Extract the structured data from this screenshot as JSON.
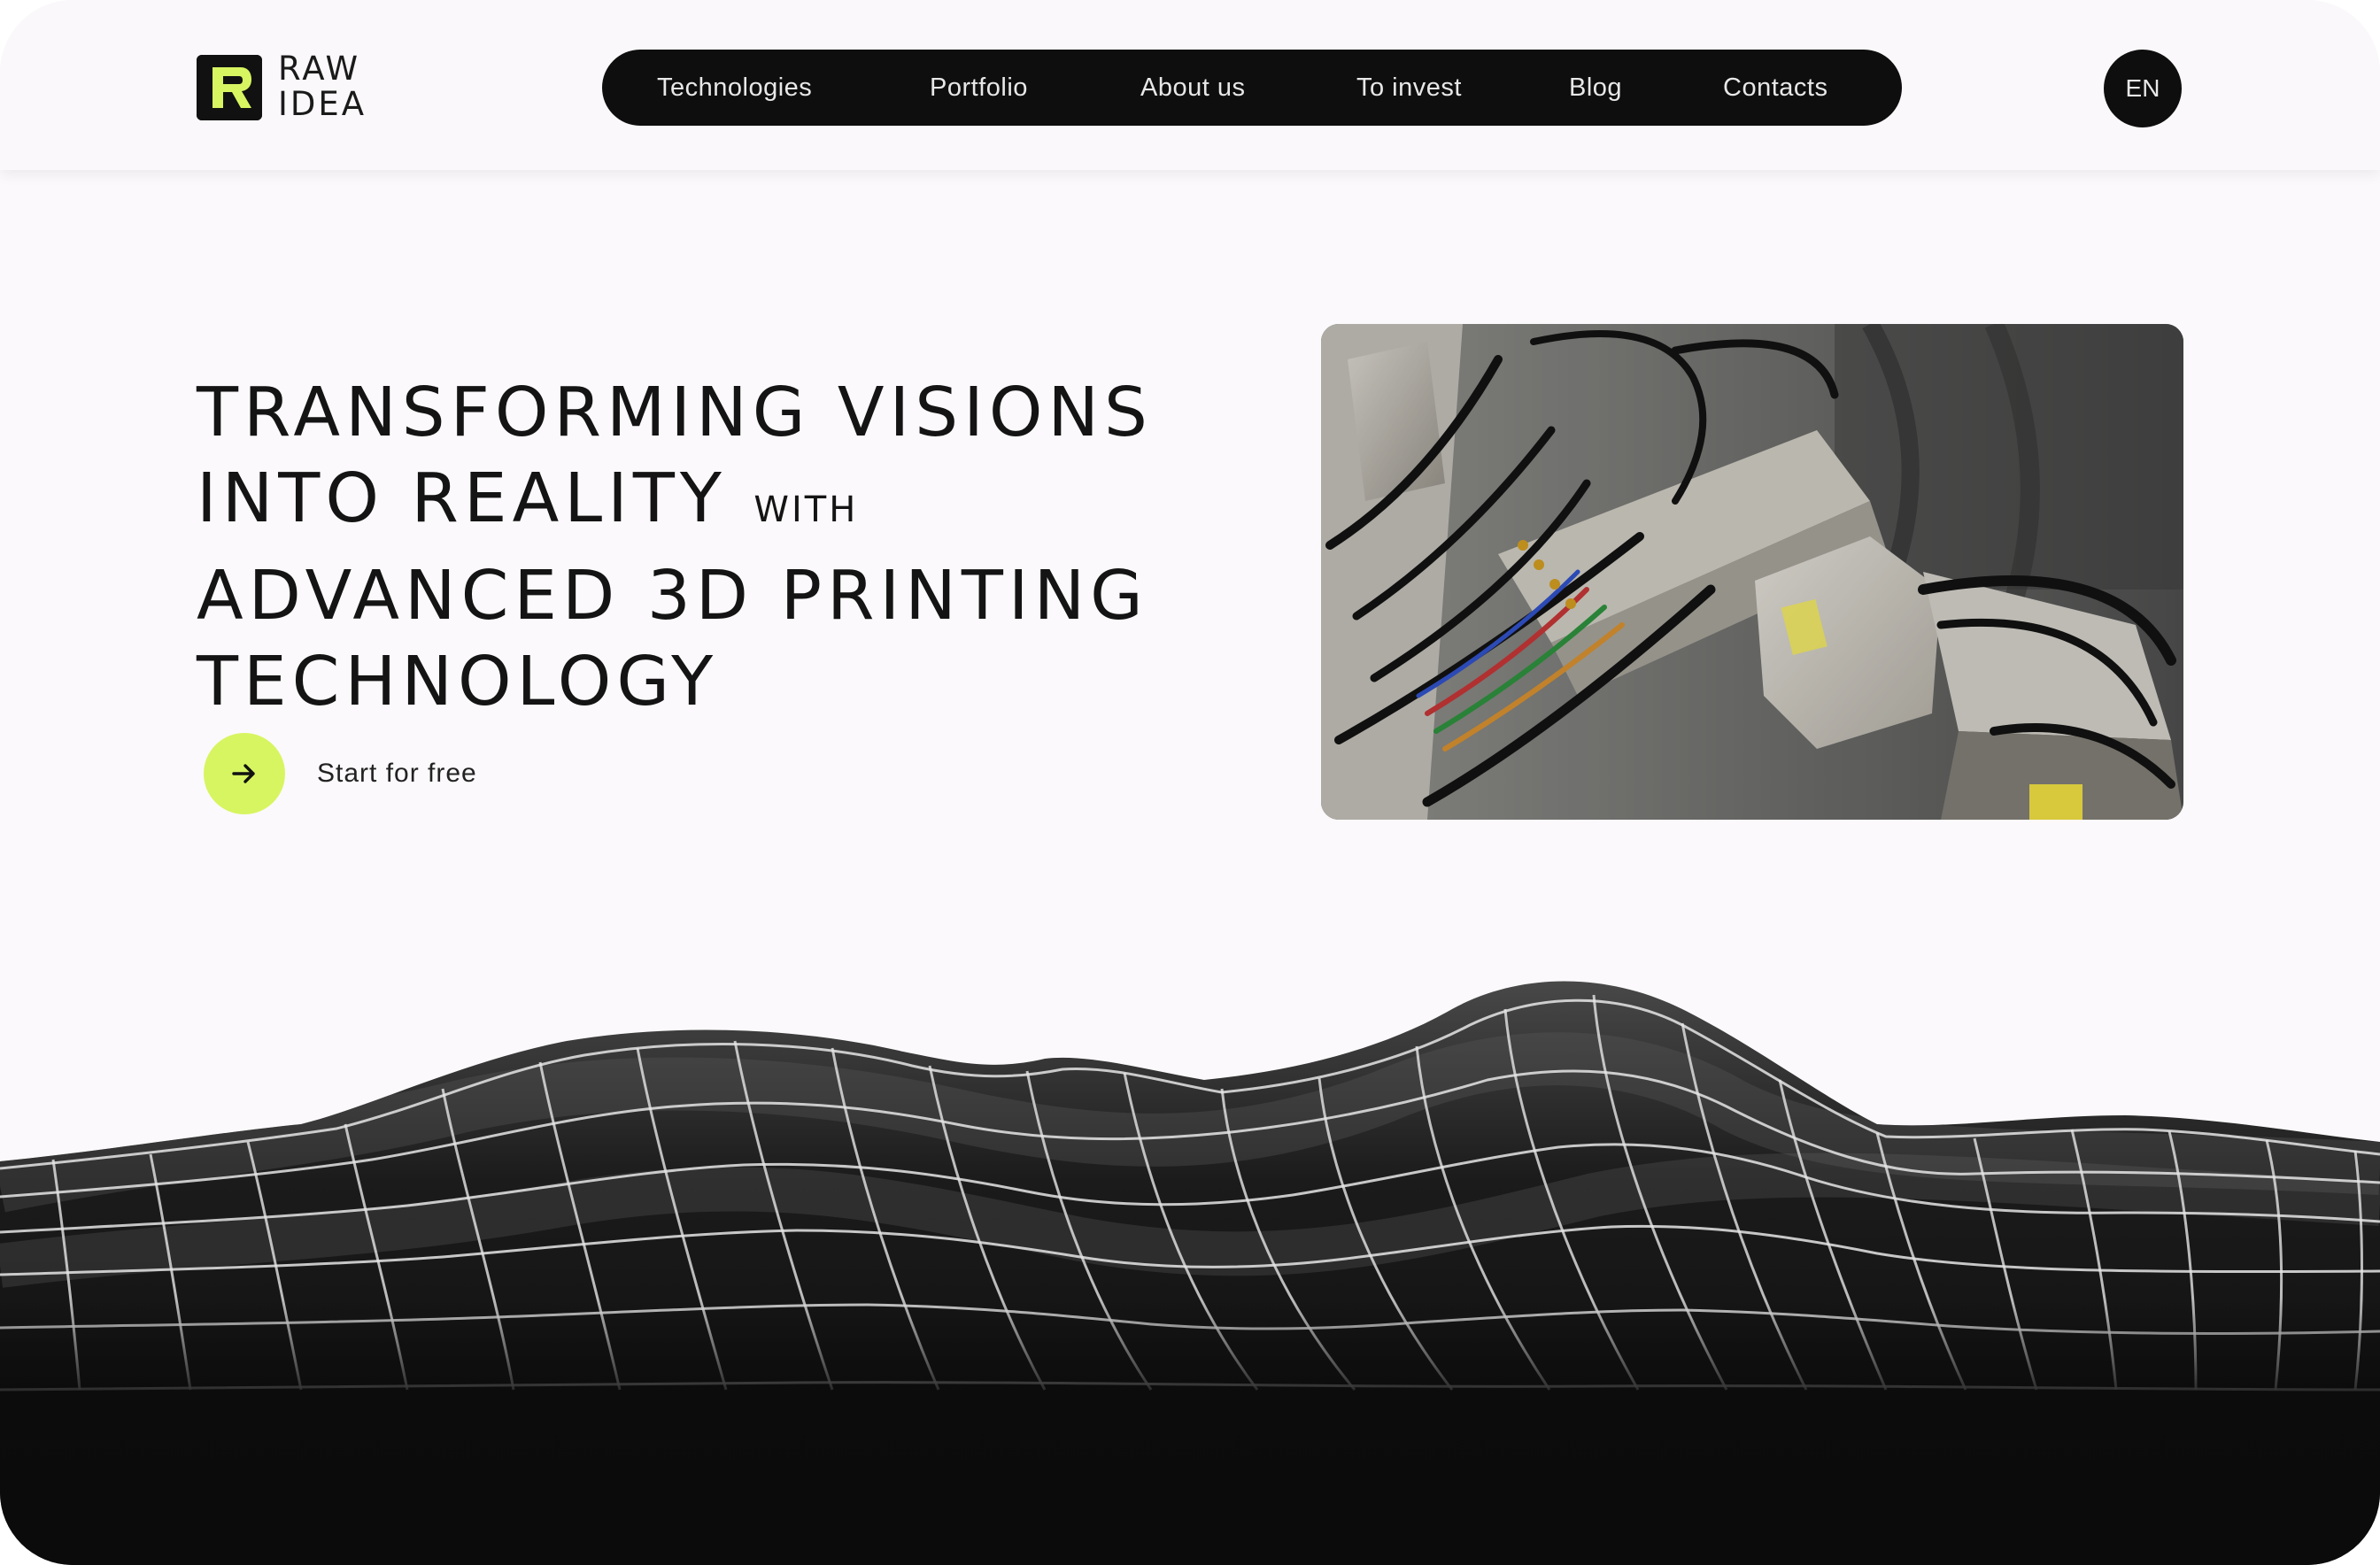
{
  "brand": {
    "name_line1": "RAW",
    "name_line2": "IDEA",
    "accent_color": "#d7f561",
    "dark_color": "#0e0e0e",
    "logo_icon": "r-logo-icon"
  },
  "nav": {
    "items": [
      {
        "label": "Technologies"
      },
      {
        "label": "Portfolio"
      },
      {
        "label": "About us"
      },
      {
        "label": "To invest"
      },
      {
        "label": "Blog"
      },
      {
        "label": "Contacts"
      }
    ],
    "language": "EN"
  },
  "hero": {
    "title_line1": "TRANSFORMING VISIONS",
    "title_line2": "INTO REALITY",
    "title_line2_small": "WITH",
    "title_line3": "ADVANCED 3D PRINTING",
    "title_line4": "TECHNOLOGY",
    "cta_label": "Start for free",
    "cta_icon": "arrow-right-icon",
    "image_subject": "3d-printer-machinery-photo"
  },
  "decor": {
    "terrain": "wireframe-terrain-graphic"
  }
}
